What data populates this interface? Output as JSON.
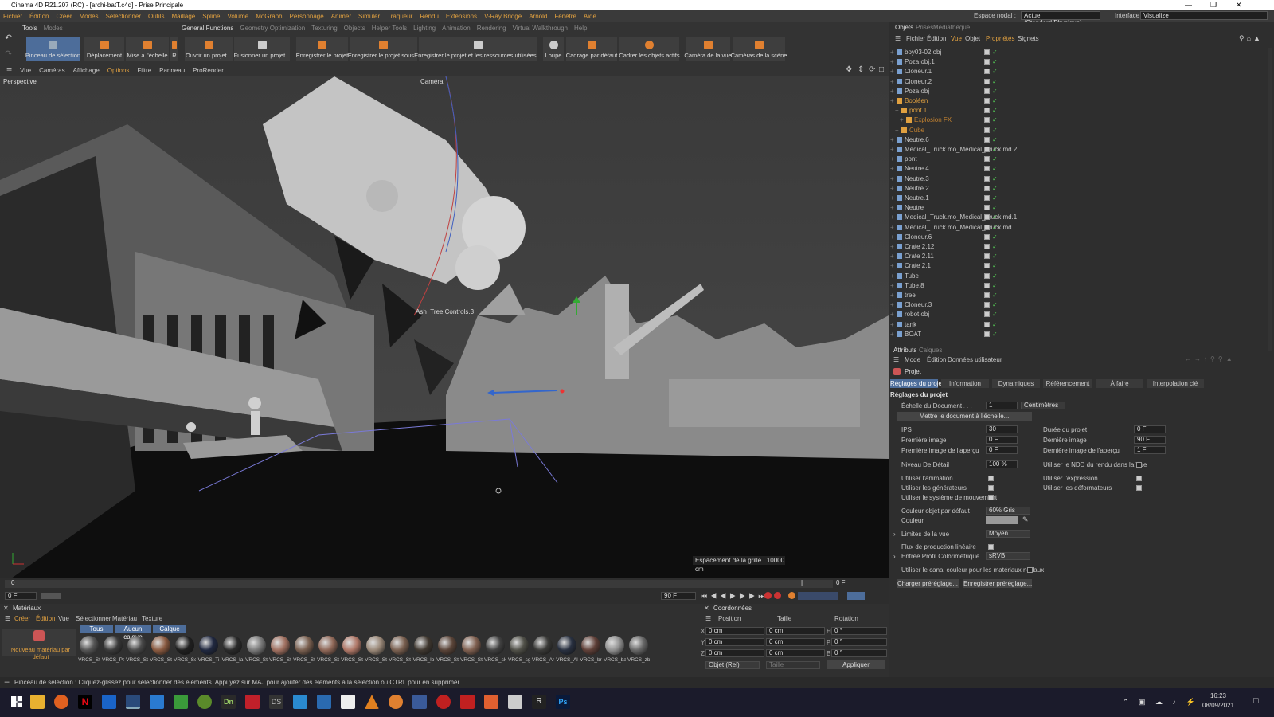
{
  "window": {
    "title": "Cinema 4D R21.207 (RC) - [archi-batT.c4d] - Prise Principale"
  },
  "menu": {
    "items": [
      "Fichier",
      "Édition",
      "Créer",
      "Modes",
      "Sélectionner",
      "Outils",
      "Maillage",
      "Spline",
      "Volume",
      "MoGraph",
      "Personnage",
      "Animer",
      "Simuler",
      "Traqueur",
      "Rendu",
      "Extensions",
      "V-Ray Bridge",
      "Arnold",
      "Fenêtre",
      "Aide"
    ],
    "nodal_label": "Espace nodal :",
    "nodal_value": "Actuel (Standard/Physique)",
    "interface_label": "Interface :",
    "interface_value": "Visualize"
  },
  "tools": {
    "left_tabs": [
      "Tools",
      "Modes"
    ],
    "tabs": [
      "General Functions",
      "Geometry Optimization",
      "Texturing",
      "Objects",
      "Helper Tools",
      "Lighting",
      "Animation",
      "Rendering",
      "Virtual Walkthrough",
      "Help"
    ],
    "buttons": [
      "Pinceau de sélection",
      "Déplacement",
      "Mise à l'échelle",
      "R",
      "Ouvrir un projet...",
      "Fusionner un projet...",
      "Enregistrer le projet",
      "Enregistrer le projet sous...",
      "Enregistrer le projet et les ressources utilisées...",
      "Loupe",
      "Cadrage par défaut",
      "Cadrer les objets actifs",
      "Caméra de la vue",
      "Caméras de la scène"
    ]
  },
  "viewport": {
    "menu": [
      "Vue",
      "Caméras",
      "Affichage",
      "Options",
      "Filtre",
      "Panneau",
      "ProRender"
    ],
    "label": "Perspective",
    "camera_label": "Caméra",
    "object_label": "Ash_Tree Controls.3",
    "grid_label": "Espacement de la grille : 10000 cm"
  },
  "timeline": {
    "marks": [
      "0",
      "0 F"
    ],
    "current": "0 F",
    "end": "90 F"
  },
  "materials": {
    "title": "Matériaux",
    "menu": [
      "Créer",
      "Édition",
      "Vue",
      "Sélectionner",
      "Matériau",
      "Texture"
    ],
    "filters": [
      "Tous",
      "Aucun calque",
      "Calque"
    ],
    "new_label": "Nouveau matériau par défaut",
    "items": [
      "VRCS_St",
      "VRCS_Pa",
      "VRCS_St",
      "VRCS_St",
      "VRCS_Sc",
      "VRCS_Ti",
      "VRCS_la",
      "VRCS_St",
      "VRCS_St",
      "VRCS_St",
      "VRCS_St",
      "VRCS_St",
      "VRCS_St",
      "VRCS_St",
      "VRCS_lo",
      "VRCS_St",
      "VRCS_St",
      "VRCS_sk",
      "VRCS_sg",
      "VRCS_Ar",
      "VRCS_Al",
      "VRCS_br",
      "VRCS_ba",
      "VRCS_zb"
    ],
    "colors": [
      "#555",
      "#3a3a3a",
      "#4a4a4a",
      "#8a5a40",
      "#202020",
      "#202840",
      "#2a2a2a",
      "#7a7a7a",
      "#a07060",
      "#7a6050",
      "#906858",
      "#b07868",
      "#9a8878",
      "#7a6050",
      "#403830",
      "#5a4438",
      "#806050",
      "#404040",
      "#505048",
      "#3a3a38",
      "#283040",
      "#604038",
      "#909090",
      "#686868"
    ]
  },
  "coords": {
    "title": "Coordonnées",
    "headers": [
      "Position",
      "Taille",
      "Rotation"
    ],
    "rows": [
      {
        "axis": "X",
        "pos": "0 cm",
        "size": "0 cm",
        "rot_axis": "H",
        "rot": "0 °"
      },
      {
        "axis": "Y",
        "pos": "0 cm",
        "size": "0 cm",
        "rot_axis": "P",
        "rot": "0 °"
      },
      {
        "axis": "Z",
        "pos": "0 cm",
        "size": "0 cm",
        "rot_axis": "B",
        "rot": "0 °"
      }
    ],
    "mode": "Objet (Rel)",
    "size_mode": "Taille",
    "apply": "Appliquer"
  },
  "objects": {
    "tabs": [
      "Objets",
      "Prises",
      "Médiathèque"
    ],
    "menu": [
      "Fichier",
      "Édition",
      "Vue",
      "Objet",
      "Propriétés",
      "Signets"
    ],
    "rows": [
      {
        "name": "boy03-02.obj",
        "color": "#c8c8c8",
        "indent": 0
      },
      {
        "name": "Poza.obj.1",
        "color": "#c8c8c8",
        "indent": 0
      },
      {
        "name": "Cloneur.1",
        "color": "#c8c8c8",
        "indent": 0
      },
      {
        "name": "Cloneur.2",
        "color": "#c8c8c8",
        "indent": 0
      },
      {
        "name": "Poza.obj",
        "color": "#c8c8c8",
        "indent": 0
      },
      {
        "name": "Booléen",
        "color": "#e0a040",
        "indent": 0
      },
      {
        "name": "pont.1",
        "color": "#e0a040",
        "indent": 1
      },
      {
        "name": "Explosion FX",
        "color": "#c08030",
        "indent": 2
      },
      {
        "name": "Cube",
        "color": "#c08030",
        "indent": 1
      },
      {
        "name": "Neutre.6",
        "color": "#c8c8c8",
        "indent": 0
      },
      {
        "name": "Medical_Truck.mo_Medical_Truck.md.2",
        "color": "#c8c8c8",
        "indent": 0
      },
      {
        "name": "pont",
        "color": "#c8c8c8",
        "indent": 0
      },
      {
        "name": "Neutre.4",
        "color": "#c8c8c8",
        "indent": 0
      },
      {
        "name": "Neutre.3",
        "color": "#c8c8c8",
        "indent": 0
      },
      {
        "name": "Neutre.2",
        "color": "#c8c8c8",
        "indent": 0
      },
      {
        "name": "Neutre.1",
        "color": "#c8c8c8",
        "indent": 0
      },
      {
        "name": "Neutre",
        "color": "#c8c8c8",
        "indent": 0
      },
      {
        "name": "Medical_Truck.mo_Medical_Truck.md.1",
        "color": "#c8c8c8",
        "indent": 0
      },
      {
        "name": "Medical_Truck.mo_Medical_Truck.md",
        "color": "#c8c8c8",
        "indent": 0
      },
      {
        "name": "Cloneur.6",
        "color": "#c8c8c8",
        "indent": 0
      },
      {
        "name": "Crate 2.12",
        "color": "#c8c8c8",
        "indent": 0
      },
      {
        "name": "Crate 2.11",
        "color": "#c8c8c8",
        "indent": 0
      },
      {
        "name": "Crate 2.1",
        "color": "#c8c8c8",
        "indent": 0
      },
      {
        "name": "Tube",
        "color": "#c8c8c8",
        "indent": 0
      },
      {
        "name": "Tube.8",
        "color": "#c8c8c8",
        "indent": 0
      },
      {
        "name": "tree",
        "color": "#c8c8c8",
        "indent": 0
      },
      {
        "name": "Cloneur.3",
        "color": "#c8c8c8",
        "indent": 0
      },
      {
        "name": "robot.obj",
        "color": "#c8c8c8",
        "indent": 0
      },
      {
        "name": "tank",
        "color": "#c8c8c8",
        "indent": 0
      },
      {
        "name": "BOAT",
        "color": "#c8c8c8",
        "indent": 0
      }
    ]
  },
  "attributes": {
    "tabs": [
      "Attributs",
      "Calques"
    ],
    "menu": [
      "Mode",
      "Édition",
      "Données utilisateur"
    ],
    "object": "Projet",
    "subtabs": [
      "Réglages du projet",
      "Information",
      "Dynamiques",
      "Référencement",
      "À faire",
      "Interpolation clé"
    ],
    "section": "Réglages du projet",
    "doc_scale_label": "Échelle du Document",
    "doc_scale_value": "1",
    "doc_scale_unit": "Centimètres",
    "scale_button": "Mettre le document à l'échelle...",
    "fps_label": "IPS",
    "fps_value": "30",
    "duration_label": "Durée du projet",
    "duration_value": "0 F",
    "first_label": "Première image",
    "first_value": "0 F",
    "last_label": "Dernière image",
    "last_value": "90 F",
    "prev_first_label": "Première image de l'aperçu",
    "prev_first_value": "0 F",
    "prev_last_label": "Dernière image de l'aperçu",
    "prev_last_value": "1 F",
    "lod_label": "Niveau De Détail",
    "lod_value": "100 %",
    "ndd_label": "Utiliser le NDD du rendu dans la Vue",
    "anim_label": "Utiliser l'animation",
    "expr_label": "Utiliser l'expression",
    "gen_label": "Utiliser les générateurs",
    "def_label": "Utiliser les déformateurs",
    "motion_label": "Utiliser le système de mouvement",
    "color_obj_label": "Couleur objet par défaut",
    "color_obj_value": "60% Gris",
    "color_label": "Couleur",
    "limits_label": "Limites de la vue",
    "limits_value": "Moyen",
    "linear_label": "Flux de production linéaire",
    "profile_label": "Entrée Profil Colorimétrique",
    "profile_value": "sRVB",
    "nodal_label": "Utiliser le canal couleur pour les matériaux nodaux",
    "load_preset": "Charger préréglage...",
    "save_preset": "Enregistrer préréglage..."
  },
  "status": {
    "text": "Pinceau de sélection : Cliquez-glissez pour sélectionner des éléments. Appuyez sur MAJ pour ajouter des éléments à la sélection ou CTRL pour en supprimer"
  },
  "taskbar": {
    "time": "16:23",
    "date": "08/09/2021",
    "apps": [
      "N",
      "DS",
      "Dn",
      "R",
      "Ps"
    ]
  }
}
